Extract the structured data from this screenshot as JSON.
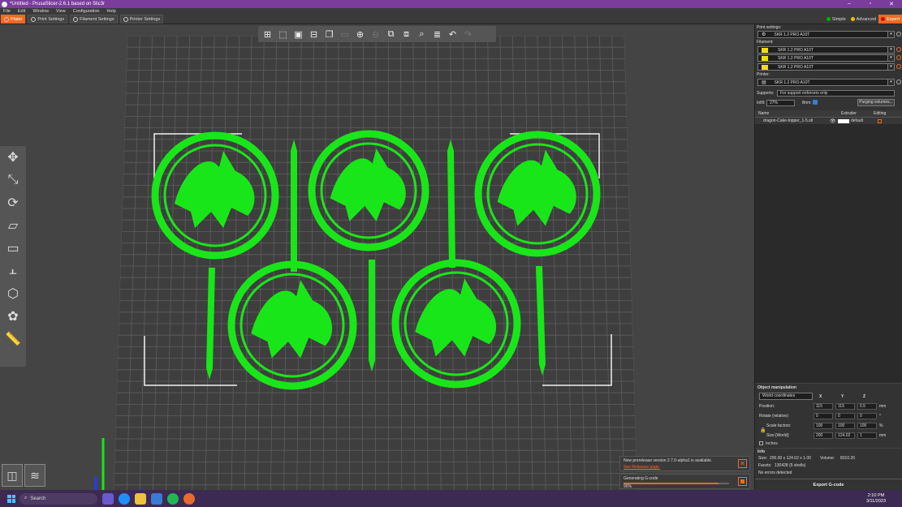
{
  "window": {
    "title": "*Untitled - PrusaSlicer-2.6.1 based on Slic3r"
  },
  "menu": [
    "File",
    "Edit",
    "Window",
    "View",
    "Configuration",
    "Help"
  ],
  "tabs": [
    {
      "label": "Plater",
      "icon": "plater-icon"
    },
    {
      "label": "Print Settings",
      "icon": "print-settings-icon"
    },
    {
      "label": "Filament Settings",
      "icon": "filament-settings-icon"
    },
    {
      "label": "Printer Settings",
      "icon": "printer-settings-icon"
    }
  ],
  "modes": [
    {
      "label": "Simple",
      "color": "#00b000"
    },
    {
      "label": "Advanced",
      "color": "#f0c000"
    },
    {
      "label": "Expert",
      "color": "#e00000"
    }
  ],
  "sidebar": {
    "print_settings_label": "Print settings:",
    "print_profile": "SKR 1.2 PRO A10T",
    "filament_label": "Filament:",
    "filaments": [
      {
        "name": "SKR 1.2 PRO A10T",
        "color": "#f0e000"
      },
      {
        "name": "SKR 1.2 PRO A10T",
        "color": "#f0e000"
      },
      {
        "name": "SKR 1.2 PRO A10T",
        "color": "#f0e000"
      }
    ],
    "printer_label": "Printer:",
    "printer_profile": "SKR 1.2 PRO A10T",
    "supports_label": "Supports:",
    "supports_value": "For support enforcers only",
    "infill_label": "Infill:",
    "infill_value": "27%",
    "brim_label": "Brim:",
    "purging_button": "Purging volumes...",
    "table_headers": {
      "name": "Name",
      "extruder": "Extruder",
      "editing": "Editing"
    },
    "object_name": "dragon-Cake-topper_1-5.stl",
    "object_extruder": "default"
  },
  "object_manipulation": {
    "title": "Object manipulation",
    "coords": "World coordinates",
    "axes": [
      "X",
      "Y",
      "Z"
    ],
    "position_label": "Position:",
    "position": [
      "115",
      "115",
      "0.5"
    ],
    "position_unit": "mm",
    "rotate_label": "Rotate (relative):",
    "rotate": [
      "0",
      "0",
      "0"
    ],
    "rotate_unit": "°",
    "scale_label": "Scale factors:",
    "scale": [
      "100",
      "100",
      "100"
    ],
    "scale_unit": "%",
    "size_label": "Size [World]:",
    "size": [
      "200",
      "124.02",
      "1"
    ],
    "size_unit": "mm",
    "inches_label": "Inches"
  },
  "info": {
    "title": "Info",
    "size_label": "Size:",
    "size_value": "200.00 x 124.02 x 1.00",
    "volume_label": "Volume:",
    "volume_value": "8310.26",
    "facets_label": "Facets:",
    "facets_value": "130428 (5 shells)",
    "errors": "No errors detected"
  },
  "export_button": "Export G-code",
  "notifications": {
    "update_text": "New prerelease version 2.7.0-alpha1 is available.",
    "update_link": "See Releases page.",
    "gcode_text": "Generating G-code",
    "gcode_percent": "90%",
    "gcode_progress": 0.9
  },
  "taskbar": {
    "search_placeholder": "Search",
    "time": "2:10 PM",
    "date": "3/11/2023"
  },
  "colors": {
    "model": "#19e619",
    "accent": "#ed6b21",
    "titlebar": "#7a3d9c"
  }
}
